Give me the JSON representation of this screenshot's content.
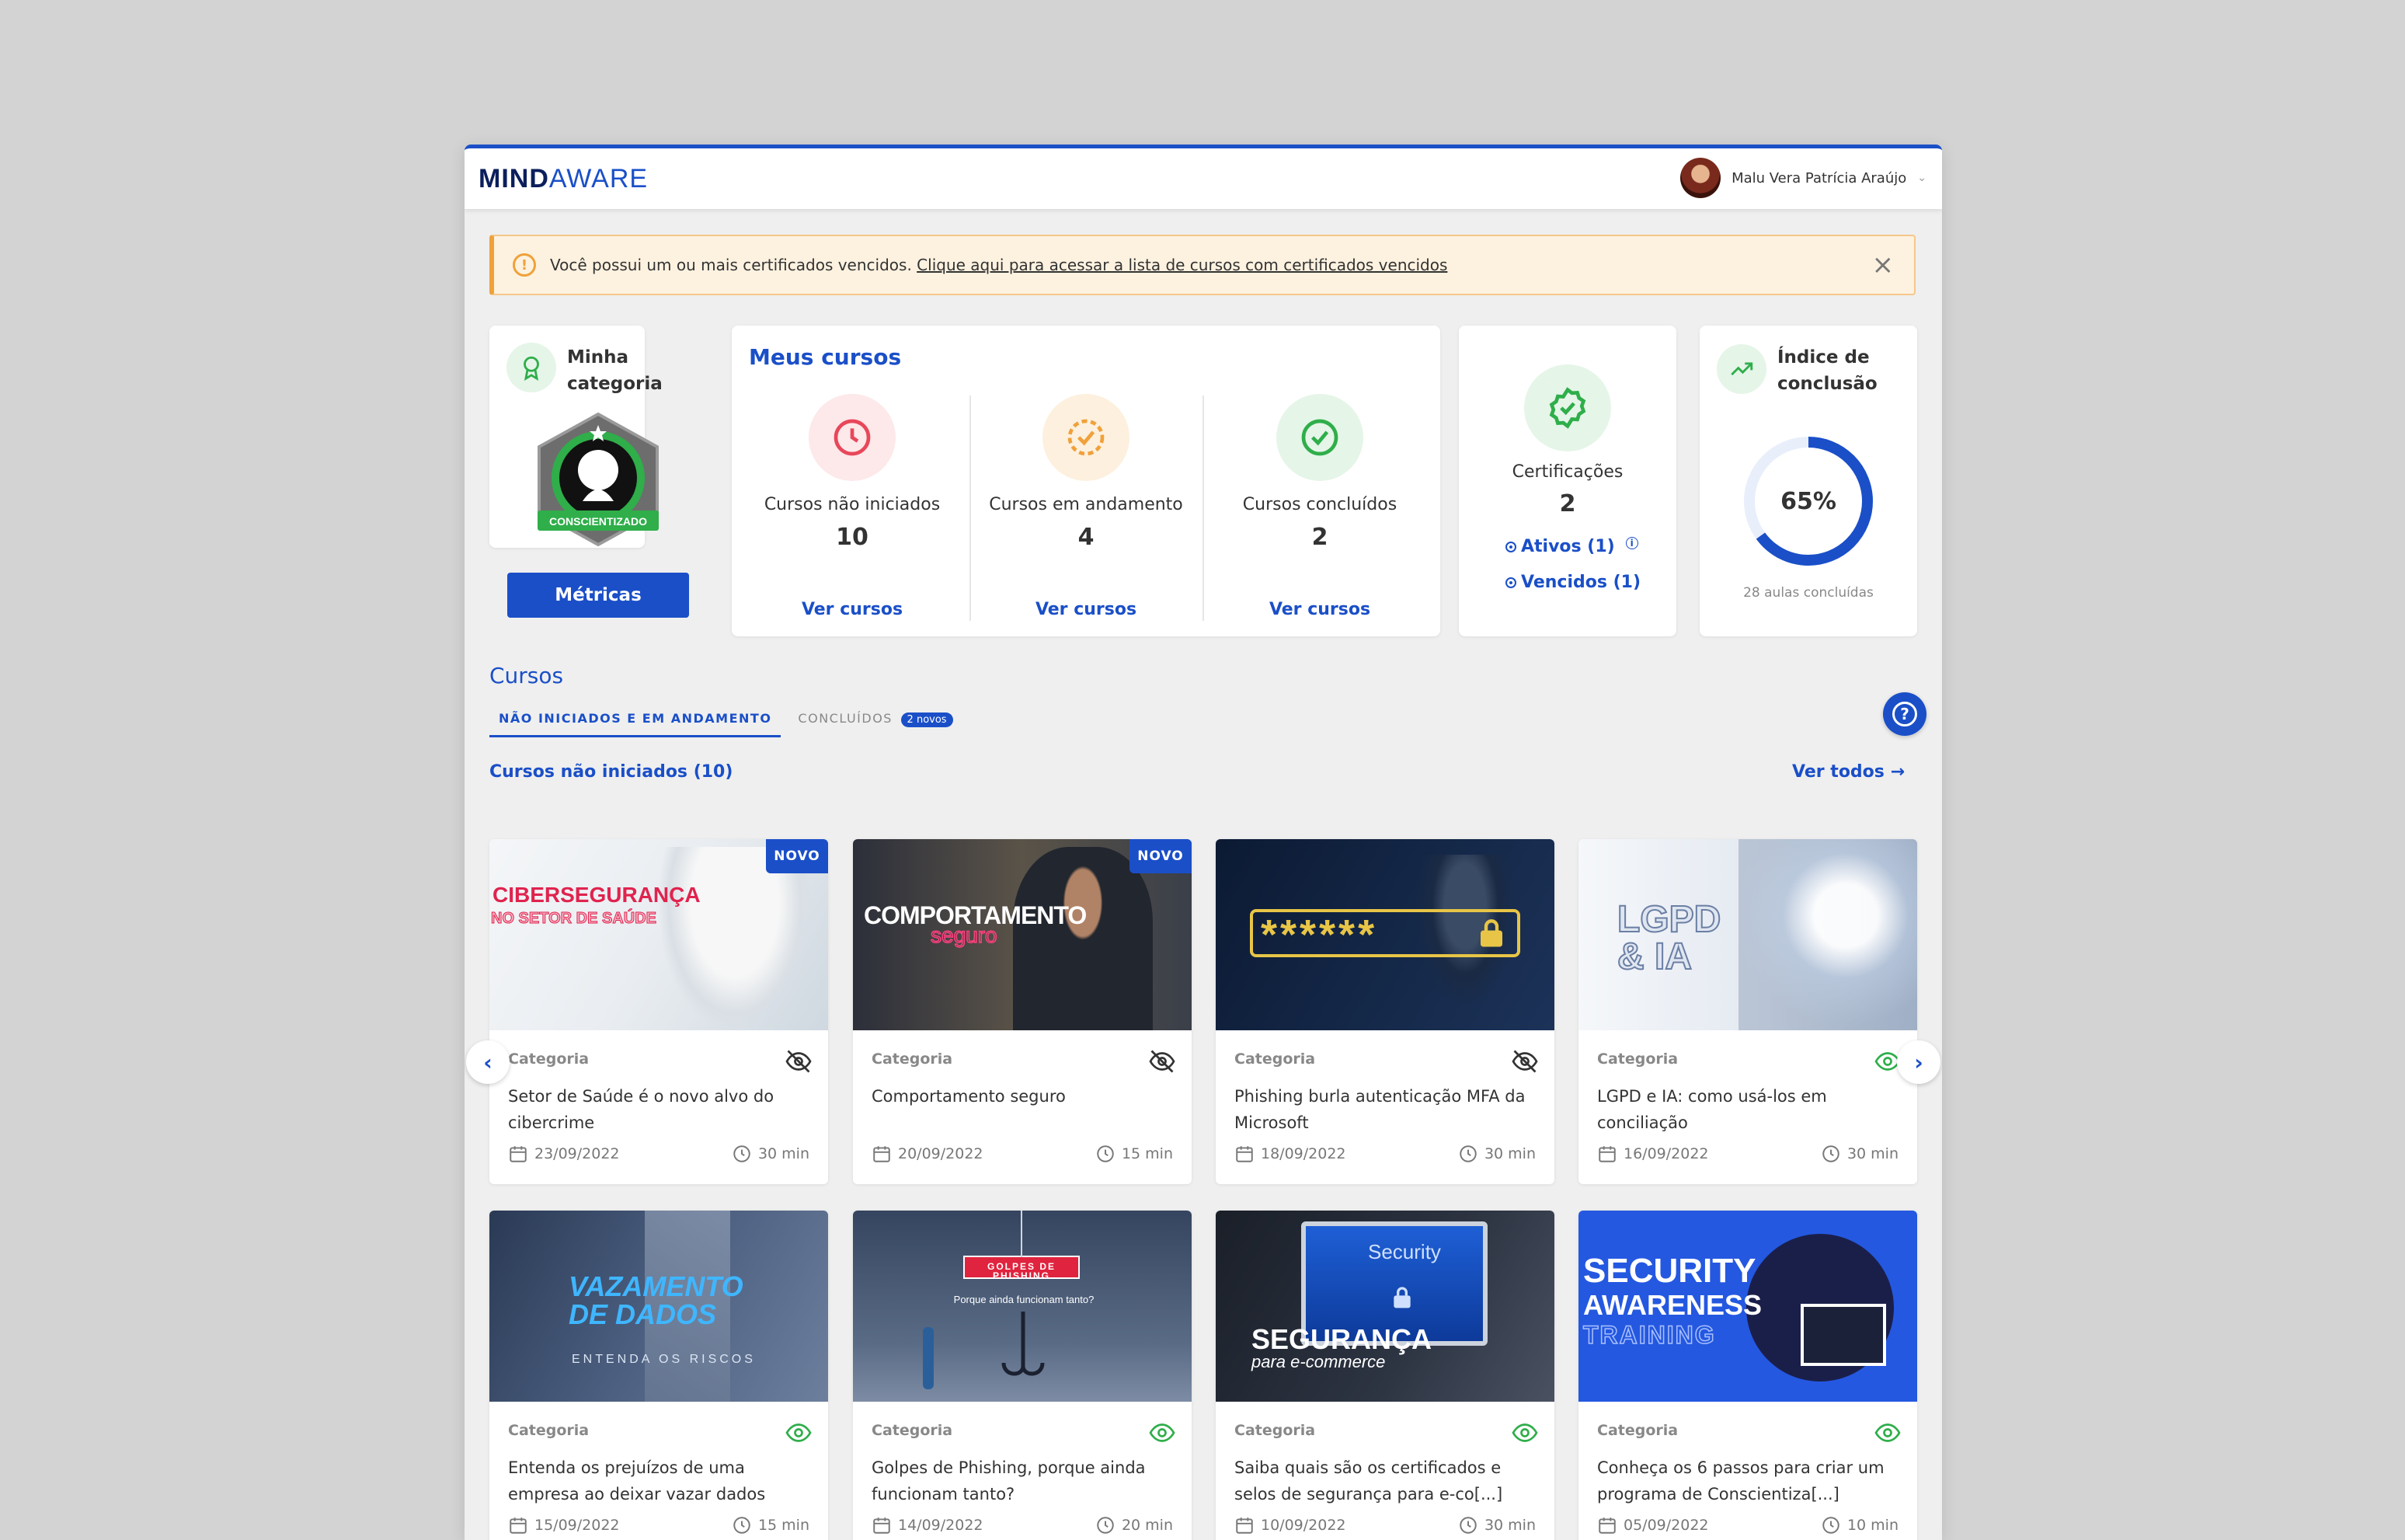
{
  "topbar": {
    "logo_part1": "MIND",
    "logo_part2": "AWARE",
    "user_name": "Malu Vera Patrícia Araújo",
    "user_menu_icon": "chevron-down-icon"
  },
  "alert": {
    "text": "Você possui um ou mais certificados vencidos.",
    "link": "Clique aqui para acessar a lista de cursos com certificados vencidos"
  },
  "category": {
    "title_line1": "Minha",
    "title_line2": "categoria",
    "badge_label": "CONSCIENTIZADO",
    "button": "Métricas"
  },
  "my_courses": {
    "title": "Meus cursos",
    "stats": [
      {
        "label": "Cursos não iniciados",
        "value": "10",
        "link": "Ver cursos",
        "color": "#e8475a"
      },
      {
        "label": "Cursos em andamento",
        "value": "4",
        "link": "Ver cursos",
        "color": "#f0a13a"
      },
      {
        "label": "Cursos concluídos",
        "value": "2",
        "link": "Ver cursos",
        "color": "#2fae4a"
      }
    ]
  },
  "certifications": {
    "label": "Certificações",
    "value": "2",
    "active": "Ativos (1)",
    "expired": "Vencidos (1)"
  },
  "completion": {
    "title_line1": "Índice de",
    "title_line2": "conclusão",
    "percent_label": "65%",
    "percent": 0.65,
    "subtitle": "28 aulas concluídas"
  },
  "courses_section": {
    "title": "Cursos",
    "tab_active": "NÃO INICIADOS E EM ANDAMENTO",
    "tab_inactive": "CONCLUÍDOS",
    "tab_pill": "2 novos",
    "subtitle": "Cursos não iniciados (10)",
    "see_all": "Ver todos"
  },
  "thumb_texts": {
    "t1a": "CIBERSEGURANÇA",
    "t1b": "NO SETOR DE SAÚDE",
    "t2a": "COMPORTAMENTO",
    "t2b": "seguro",
    "t3": "******",
    "t4a": "LGPD",
    "t4b": "& IA",
    "t5a": "VAZAMENTO",
    "t5b": "DE DADOS",
    "t5c": "ENTENDA OS RISCOS",
    "t6a": "GOLPES DE PHISHING",
    "t6b": "Porque ainda funcionam tanto?",
    "t7a": "Security",
    "t7b": "SEGURANÇA",
    "t7c": "para e-commerce",
    "t8a": "SECURITY",
    "t8b": "AWARENESS",
    "t8c": "TRAINING"
  },
  "new_label": "NOVO",
  "cards": [
    {
      "category": "Categoria",
      "title": "Setor de Saúde é o novo alvo do cibercrime",
      "date": "23/09/2022",
      "duration": "30 min",
      "viewed": false
    },
    {
      "category": "Categoria",
      "title": "Comportamento seguro",
      "date": "20/09/2022",
      "duration": "15 min",
      "viewed": false
    },
    {
      "category": "Categoria",
      "title": "Phishing burla autenticação MFA da Microsoft",
      "date": "18/09/2022",
      "duration": "30 min",
      "viewed": false
    },
    {
      "category": "Categoria",
      "title": "LGPD e IA: como usá-los em conciliação",
      "date": "16/09/2022",
      "duration": "30 min",
      "viewed": true
    },
    {
      "category": "Categoria",
      "title": "Entenda os prejuízos de uma empresa ao deixar vazar dados",
      "date": "15/09/2022",
      "duration": "15 min",
      "viewed": true
    },
    {
      "category": "Categoria",
      "title": "Golpes de Phishing, porque ainda funcionam tanto?",
      "date": "14/09/2022",
      "duration": "20 min",
      "viewed": true
    },
    {
      "category": "Categoria",
      "title": "Saiba quais são os certificados e selos de segurança para e-co[...]",
      "date": "10/09/2022",
      "duration": "30 min",
      "viewed": true
    },
    {
      "category": "Categoria",
      "title": "Conheça os 6 passos para criar um programa de Conscientiza[...]",
      "date": "05/09/2022",
      "duration": "10 min",
      "viewed": true
    }
  ],
  "colors": {
    "primary": "#1a4fc8",
    "success": "#2fae4a",
    "warning": "#f0a13a",
    "danger": "#e8475a"
  }
}
